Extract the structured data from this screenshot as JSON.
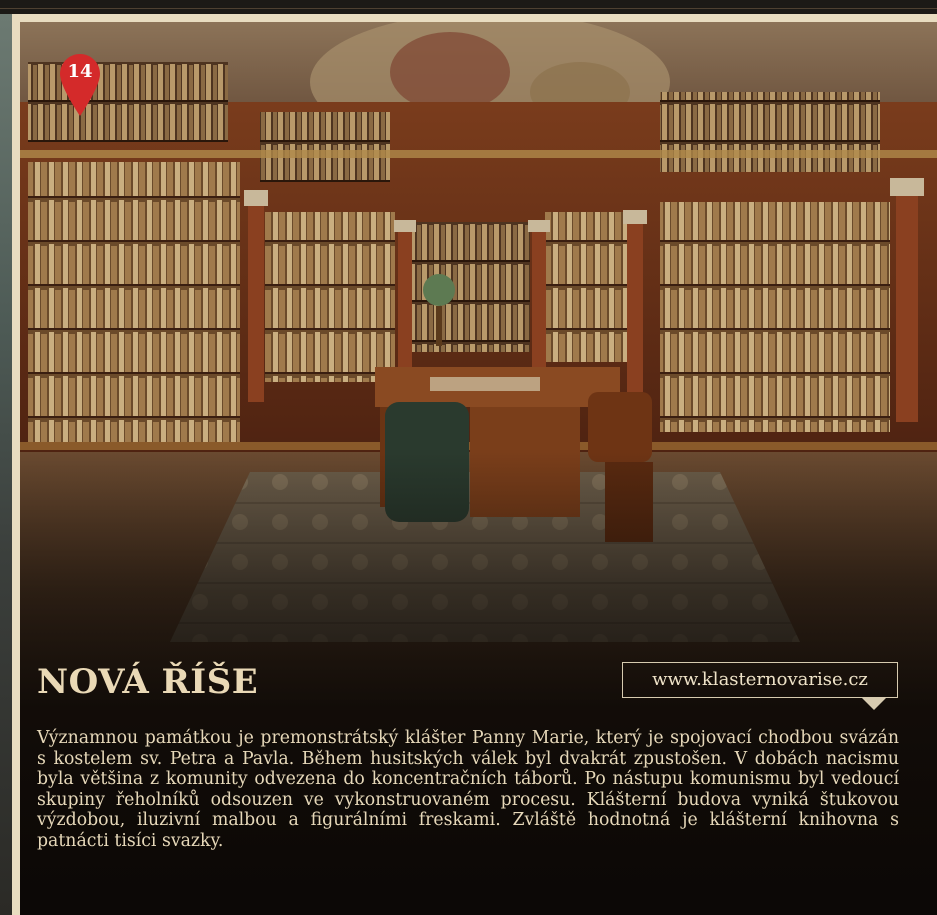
{
  "marker": {
    "number": "14",
    "color": "#d42a2a",
    "icon": "map-pin-icon"
  },
  "place": {
    "title": "NOVÁ ŘÍŠE",
    "url": "www.klasternovarise.cz",
    "description": "Významnou památkou je premonstrátský klášter Panny Marie, který je spojovací chodbou svázán s kostelem sv. Petra a Pavla. Během husitských válek byl dvakrát zpustošen. V dobách nacismu byla většina z komunity odvezena do koncentračních táborů. Po nástupu komunismu byl vedoucí skupiny řeholníků odsouzen ve vykonstruovaném procesu. Klášterní budova vyniká štukovou výzdobou, iluzivní malbou a figurálními freskami. Zvláště hodnotná je klášterní knihovna s patnácti tisíci svazky."
  },
  "colors": {
    "page_background": "#e8dcc0",
    "text": "#e6d8b9",
    "photo_shadow": "#1b120c"
  }
}
